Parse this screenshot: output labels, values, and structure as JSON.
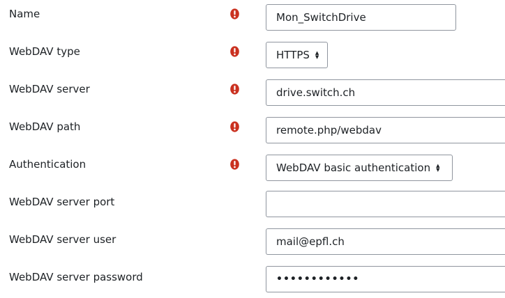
{
  "colors": {
    "required": "#ca3120",
    "border": "#8f959e",
    "text": "#1d2125"
  },
  "icons": {
    "required": "exclamation-circle-icon"
  },
  "fields": [
    {
      "label": "Name",
      "required": true,
      "kind": "text",
      "value": "Mon_SwitchDrive"
    },
    {
      "label": "WebDAV type",
      "required": true,
      "kind": "select",
      "value": "HTTPS"
    },
    {
      "label": "WebDAV server",
      "required": true,
      "kind": "text",
      "value": "drive.switch.ch"
    },
    {
      "label": "WebDAV path",
      "required": true,
      "kind": "text",
      "value": "remote.php/webdav"
    },
    {
      "label": "Authentication",
      "required": true,
      "kind": "select",
      "value": "WebDAV basic authentication"
    },
    {
      "label": "WebDAV server port",
      "required": false,
      "kind": "text",
      "value": ""
    },
    {
      "label": "WebDAV server user",
      "required": false,
      "kind": "text",
      "value": "mail@epfl.ch"
    },
    {
      "label": "WebDAV server password",
      "required": false,
      "kind": "password",
      "value": "••••••••••••"
    }
  ]
}
